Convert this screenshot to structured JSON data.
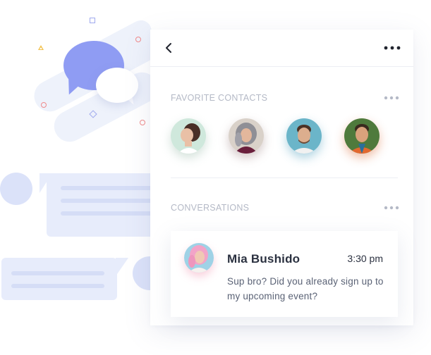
{
  "header": {
    "back_icon": "chevron-left-icon",
    "more_icon": "more-horizontal-icon"
  },
  "favorites": {
    "title": "FAVORITE CONTACTS",
    "more_icon": "more-horizontal-icon",
    "contacts": [
      {
        "avatar_bg": "#cfe8dc",
        "hair": "#4a2f27",
        "shirt": "#ffffff",
        "skin": "#e9c0a6"
      },
      {
        "avatar_bg": "#d9d1c9",
        "hair": "#8f8f96",
        "shirt": "#6a1f3c",
        "skin": "#e3b79c"
      },
      {
        "avatar_bg": "#6bb5c9",
        "hair": "#4b3226",
        "shirt": "#f1f1f1",
        "skin": "#dcae8e"
      },
      {
        "avatar_bg": "#4f7a3c",
        "hair": "#3a2a1e",
        "shirt": "#e2682f",
        "skin": "#d9a27c"
      }
    ]
  },
  "conversations": {
    "title": "CONVERSATIONS",
    "more_icon": "more-horizontal-icon",
    "items": [
      {
        "name": "Mia Bushido",
        "time": "3:30 pm",
        "message": "Sup bro? Did you already sign up to my upcoming event?",
        "avatar_bg": "#9fd2e6",
        "hair": "#f2a4c8",
        "skin": "#f0c9b4"
      }
    ]
  },
  "colors": {
    "accent_bubble": "#8f9cf3",
    "muted_text": "#b4b9c6",
    "dark_text": "#2b3140",
    "body_text": "#5a6275",
    "illustration_blue": "#e7ecfb"
  }
}
